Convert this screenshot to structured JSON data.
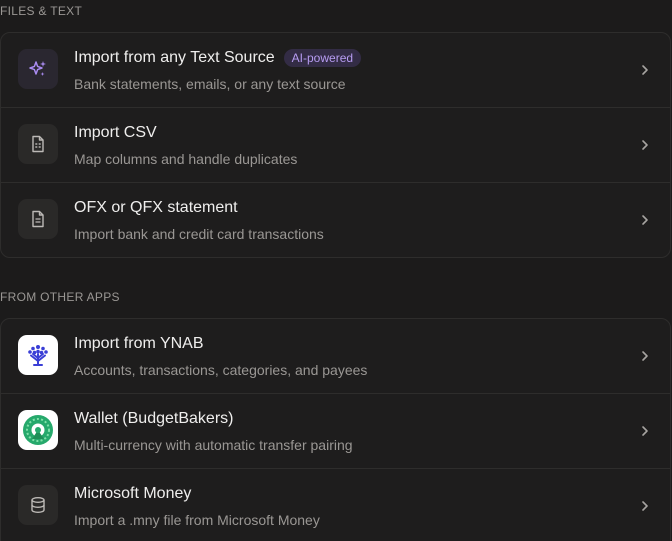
{
  "sections": [
    {
      "label": "FILES & TEXT",
      "items": [
        {
          "title": "Import from any Text Source",
          "badge": "AI-powered",
          "subtitle": "Bank statements, emails, or any text source",
          "icon": "sparkles-icon"
        },
        {
          "title": "Import CSV",
          "subtitle": "Map columns and handle duplicates",
          "icon": "csv-file-icon"
        },
        {
          "title": "OFX or QFX statement",
          "subtitle": "Import bank and credit card transactions",
          "icon": "document-icon"
        }
      ]
    },
    {
      "label": "FROM OTHER APPS",
      "items": [
        {
          "title": "Import from YNAB",
          "subtitle": "Accounts, transactions, categories, and payees",
          "icon": "ynab-tree-icon"
        },
        {
          "title": "Wallet (BudgetBakers)",
          "subtitle": "Multi-currency with automatic transfer pairing",
          "icon": "wallet-budgetbakers-icon"
        },
        {
          "title": "Microsoft Money",
          "subtitle": "Import a .mny file from Microsoft Money",
          "icon": "database-icon"
        }
      ]
    }
  ],
  "colors": {
    "background": "#1c1b1b",
    "accent_purple": "#b79cf2",
    "ynab_blue": "#3a3fd6",
    "wallet_green": "#26a96c"
  }
}
